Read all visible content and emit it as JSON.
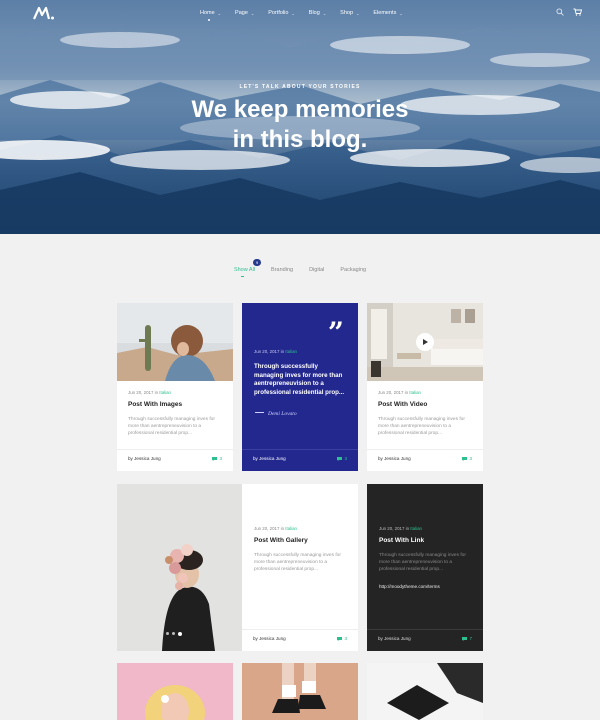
{
  "nav": {
    "items": [
      {
        "label": "Home"
      },
      {
        "label": "Page"
      },
      {
        "label": "Portfolio"
      },
      {
        "label": "Blog"
      },
      {
        "label": "Shop"
      },
      {
        "label": "Elements"
      }
    ],
    "active_index": 0
  },
  "hero": {
    "kicker": "LET'S TALK ABOUT YOUR STORIES",
    "title_line1": "We keep memories",
    "title_line2": "in this blog."
  },
  "filters": {
    "items": [
      {
        "label": "Show All",
        "count": "9"
      },
      {
        "label": "Branding"
      },
      {
        "label": "Digital"
      },
      {
        "label": "Packaging"
      }
    ]
  },
  "posts": [
    {
      "date": "Jun 20, 2017",
      "in": "in",
      "category": "Italian",
      "title": "Post With Images",
      "excerpt": "Through successfully managing inves for more than aentrepreneuvision to a professional residential prop...",
      "author": "by Jessica Jung",
      "comments": "3"
    },
    {
      "date": "Jun 20, 2017",
      "in": "in",
      "category": "Italian",
      "quote": "Through successfully managing inves for more than aentrepreneuvision to a professional residential prop...",
      "quote_author": "Demi Lovato",
      "author": "by Jessica Jung",
      "comments": "3"
    },
    {
      "date": "Jun 20, 2017",
      "in": "in",
      "category": "Italian",
      "title": "Post With Video",
      "excerpt": "Through successfully managing inves for more than aentrepreneuvision to a professional residential prop...",
      "author": "by Jessica Jung",
      "comments": "3"
    },
    {
      "date": "Jun 20, 2017",
      "in": "in",
      "category": "Italian",
      "title": "Post With Gallery",
      "excerpt": "Through successfully managing inves for more than aentrepreneuvision to a professional residential prop...",
      "author": "by Jessica Jung",
      "comments": "3"
    },
    {
      "date": "Jun 20, 2017",
      "in": "in",
      "category": "Italian",
      "title": "Post With Link",
      "excerpt": "Through successfully managing inves for more than aentrepreneuvision to a professional residential prop...",
      "link": "http://moodytheme.com/terms",
      "author": "by Jessica Jung",
      "comments": "7"
    }
  ],
  "colors": {
    "accent": "#2ebf91",
    "quote_bg": "#23288e",
    "dark_card": "#242424"
  }
}
